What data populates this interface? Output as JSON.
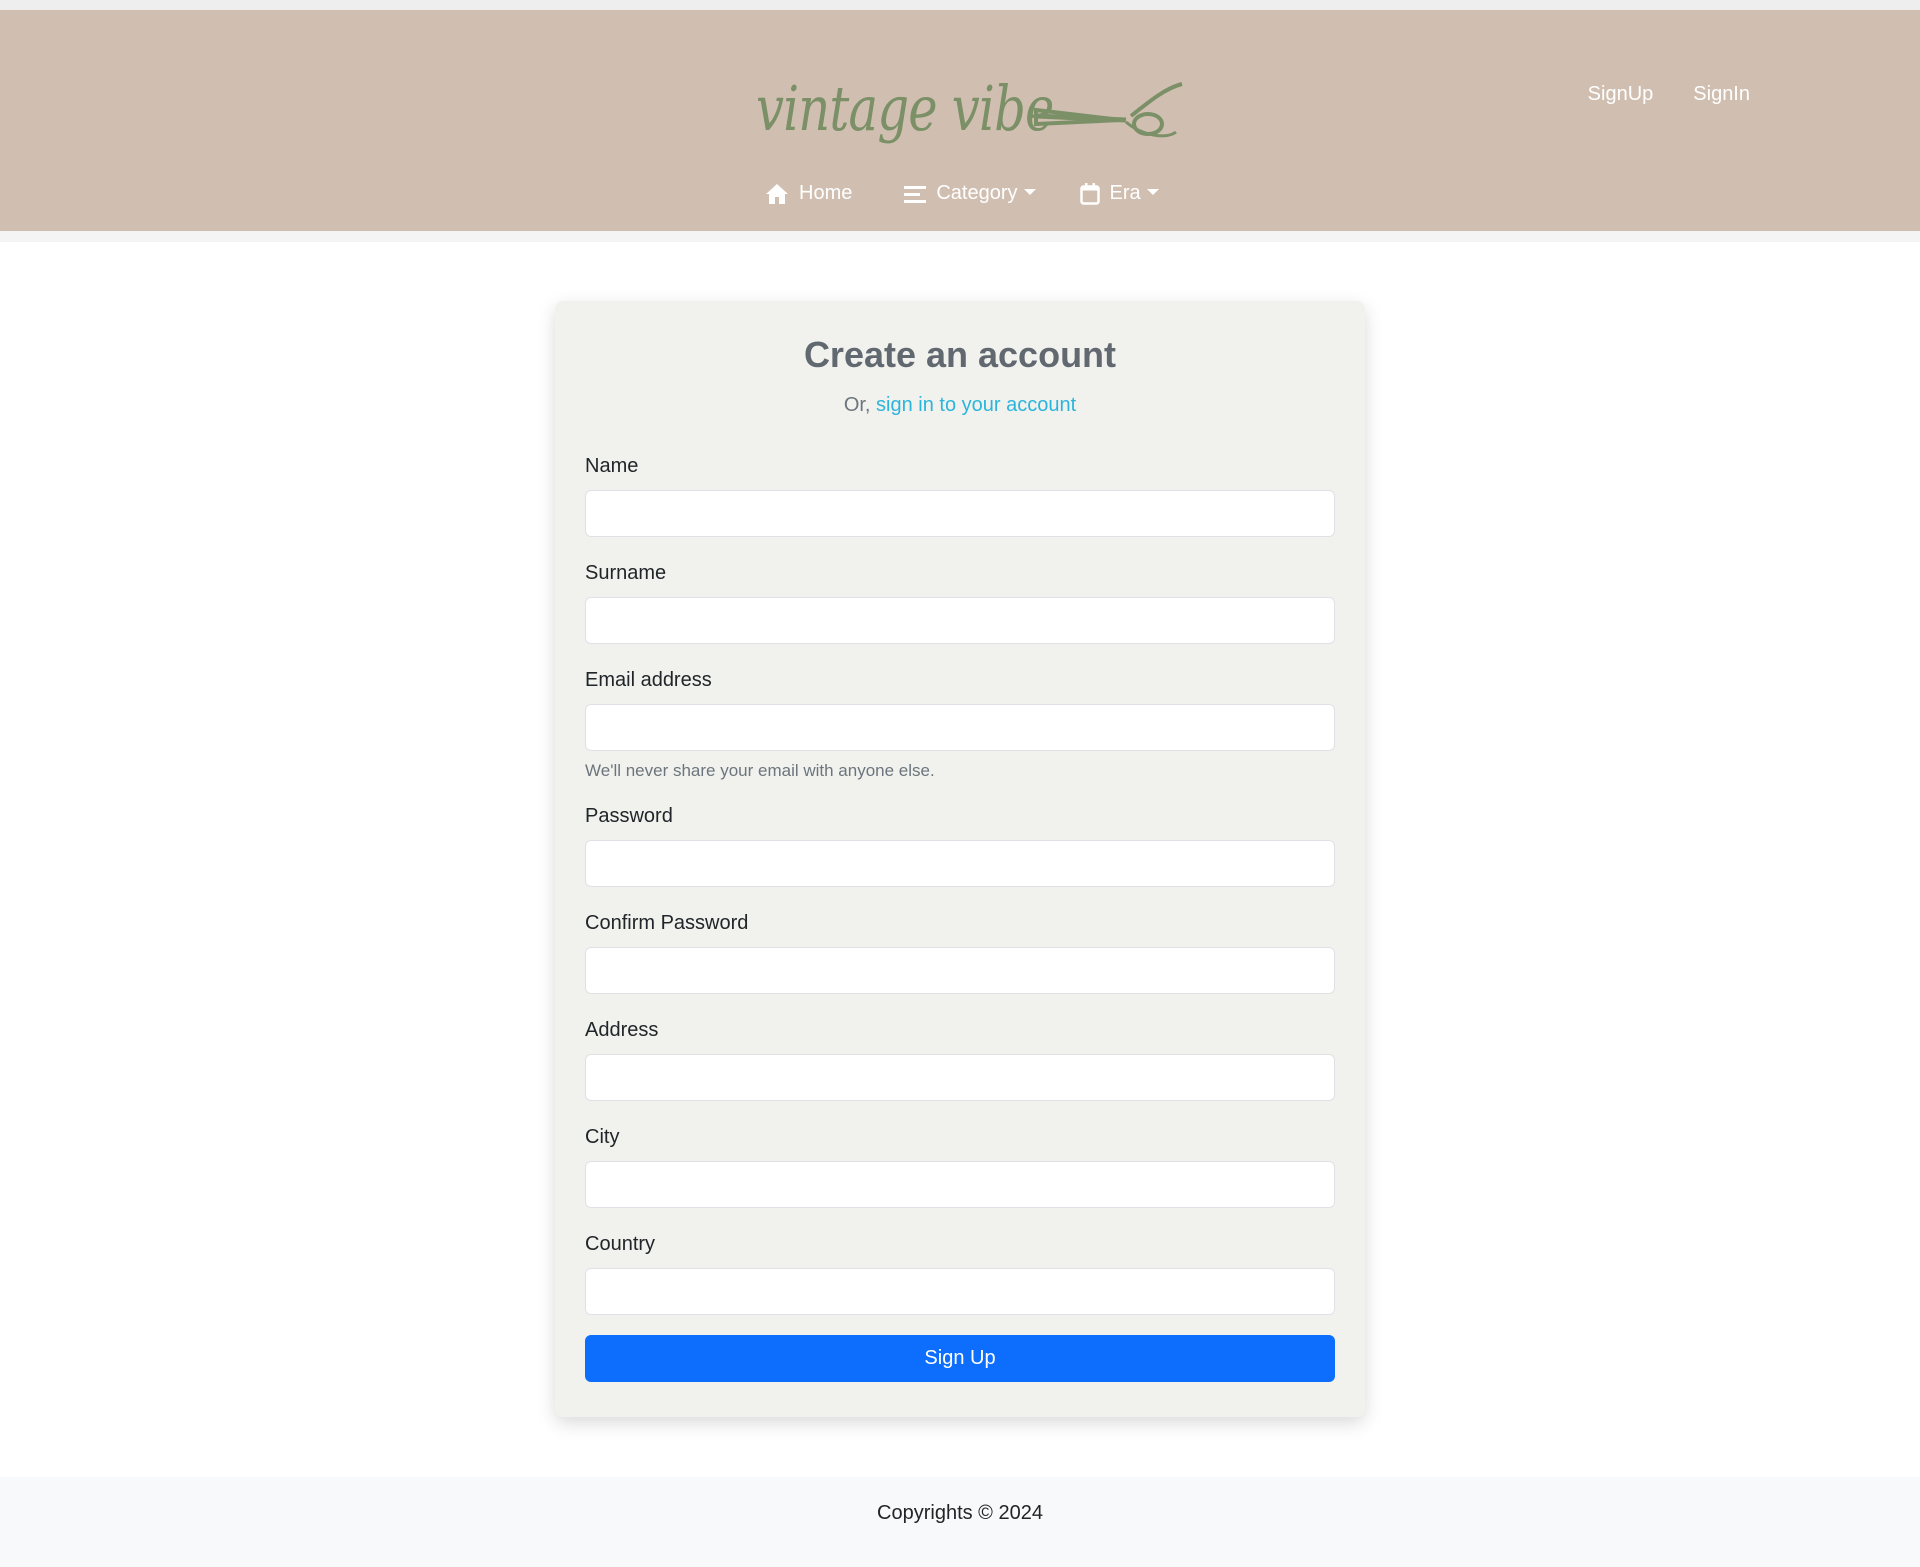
{
  "brand": {
    "name": "vintage vibe",
    "logo_color": "#7c9068"
  },
  "auth": {
    "signup_label": "SignUp",
    "signin_label": "SignIn"
  },
  "nav": {
    "home": {
      "label": "Home",
      "icon": "home-icon"
    },
    "category": {
      "label": "Category",
      "icon": "menu-lines-icon"
    },
    "era": {
      "label": "Era",
      "icon": "calendar-icon"
    }
  },
  "form": {
    "title": "Create an account",
    "subtitle_prefix": "Or,",
    "signin_link": "sign in to your account",
    "fields": [
      {
        "label": "Name",
        "value": ""
      },
      {
        "label": "Surname",
        "value": ""
      },
      {
        "label": "Email address",
        "value": "",
        "help": "We'll never share your email with anyone else."
      },
      {
        "label": "Password",
        "value": ""
      },
      {
        "label": "Confirm Password",
        "value": ""
      },
      {
        "label": "Address",
        "value": ""
      },
      {
        "label": "City",
        "value": ""
      },
      {
        "label": "Country",
        "value": ""
      }
    ],
    "submit_label": "Sign Up"
  },
  "footer": {
    "text": "Copyrights © 2024"
  },
  "colors": {
    "header_bg": "#d0bfb1",
    "card_bg": "#f1f2ee",
    "primary": "#0d6efd",
    "link": "#2bb5dc"
  }
}
